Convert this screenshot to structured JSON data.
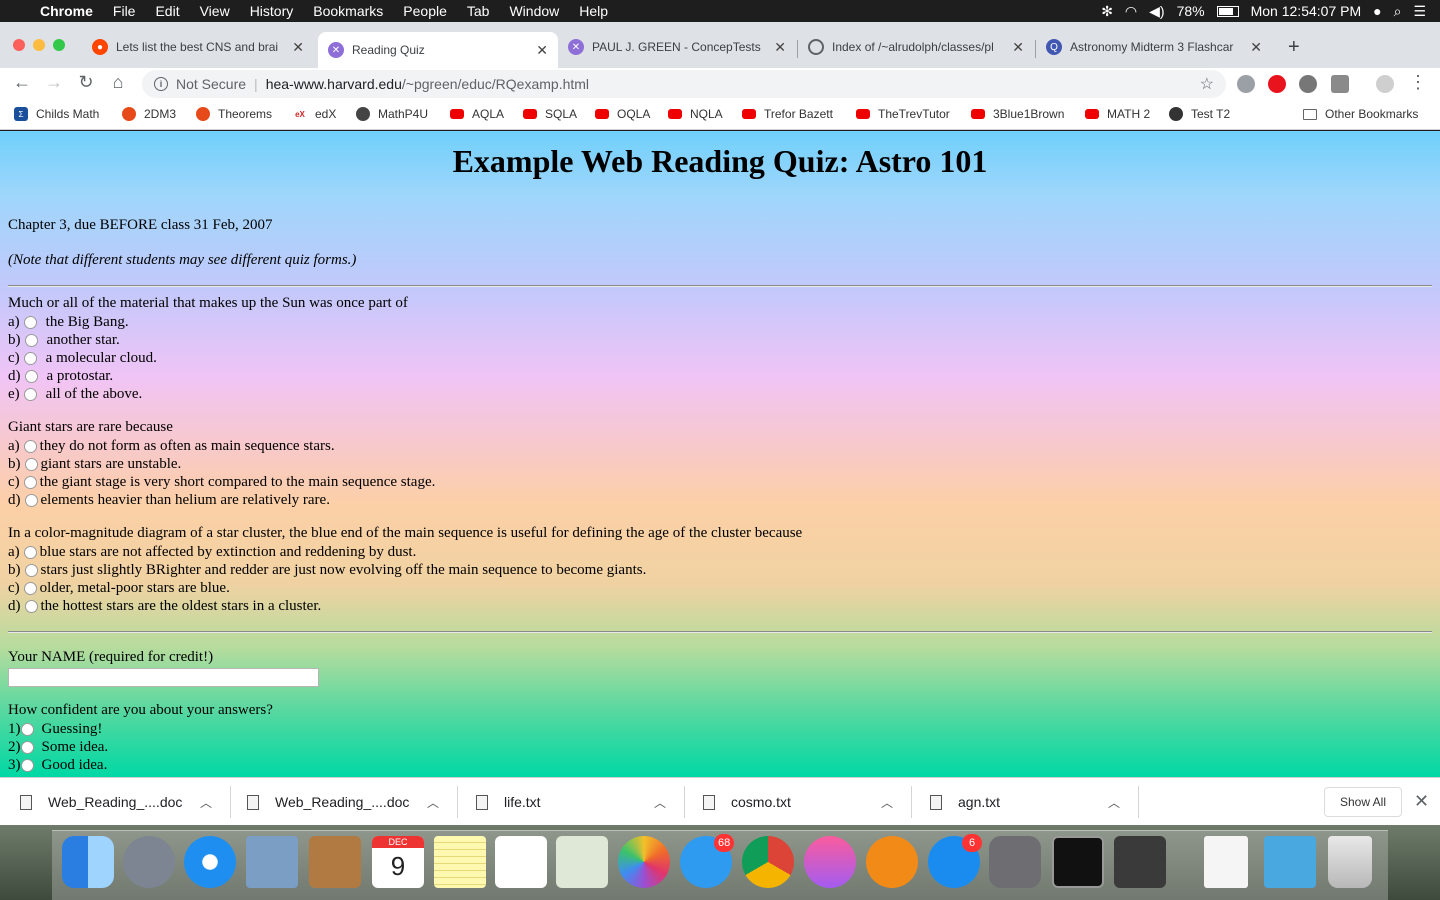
{
  "menubar": {
    "app_name": "Chrome",
    "items": [
      "File",
      "Edit",
      "View",
      "History",
      "Bookmarks",
      "People",
      "Tab",
      "Window",
      "Help"
    ],
    "battery": "78%",
    "clock": "Mon 12:54:07 PM"
  },
  "tabs": [
    {
      "label": "Lets list the best CNS and brai",
      "icon": "reddit-icon"
    },
    {
      "label": "Reading Quiz",
      "icon": "quiz-icon"
    },
    {
      "label": "PAUL J. GREEN - ConcepTests",
      "icon": "quiz-icon"
    },
    {
      "label": "Index of /~alrudolph/classes/pl",
      "icon": "loading-icon"
    },
    {
      "label": "Astronomy Midterm 3 Flashcar",
      "icon": "quizlet-icon"
    }
  ],
  "omnibox": {
    "security": "Not Secure",
    "host": "hea-www.harvard.edu",
    "path": "/~pgreen/educ/RQexamp.html"
  },
  "bookmarks": [
    "Childs Math",
    "2DM3",
    "Theorems",
    "edX",
    "MathP4U",
    "AQLA",
    "SQLA",
    "OQLA",
    "NQLA",
    "Trefor Bazett",
    "TheTrevTutor",
    "3Blue1Brown",
    "MATH 2",
    "Test T2"
  ],
  "other_bookmarks": "Other Bookmarks",
  "page": {
    "title": "Example Web Reading Quiz: Astro 101",
    "due": "Chapter 3, due BEFORE class 31 Feb, 2007",
    "note": "(Note that different students may see different quiz forms.)",
    "questions": [
      {
        "text": "Much or all of the material that makes up the Sun was once part of",
        "options": [
          {
            "letter": "a)",
            "text": "the Big Bang."
          },
          {
            "letter": "b)",
            "text": "another star."
          },
          {
            "letter": "c)",
            "text": "a molecular cloud."
          },
          {
            "letter": "d)",
            "text": "a protostar."
          },
          {
            "letter": "e)",
            "text": "all of the above."
          }
        ]
      },
      {
        "text": "Giant stars are rare because",
        "options": [
          {
            "letter": "a)",
            "text": "they do not form as often as main sequence stars."
          },
          {
            "letter": "b)",
            "text": "giant stars are unstable."
          },
          {
            "letter": "c)",
            "text": "the giant stage is very short compared to the main sequence stage."
          },
          {
            "letter": "d)",
            "text": "elements heavier than helium are relatively rare."
          }
        ]
      },
      {
        "text": "In a color-magnitude diagram of a star cluster, the blue end of the main sequence is useful for defining the age of the cluster because",
        "options": [
          {
            "letter": "a)",
            "text": "blue stars are not affected by extinction and reddening by dust."
          },
          {
            "letter": "b)",
            "text": "stars just slightly BRighter and redder are just now evolving off the main sequence to become giants."
          },
          {
            "letter": "c)",
            "text": "older, metal-poor stars are blue."
          },
          {
            "letter": "d)",
            "text": "the hottest stars are the oldest stars in a cluster."
          }
        ]
      }
    ],
    "name_label": "Your NAME (required for credit!)",
    "name_value": "",
    "confidence_question": "How confident are you about your answers?",
    "confidence_options": [
      {
        "letter": "1)",
        "text": "Guessing!"
      },
      {
        "letter": "2)",
        "text": "Some idea."
      },
      {
        "letter": "3)",
        "text": "Good idea."
      }
    ]
  },
  "downloads": [
    "Web_Reading_....doc",
    "Web_Reading_....doc",
    "life.txt",
    "cosmo.txt",
    "agn.txt"
  ],
  "show_all": "Show All",
  "dock": {
    "calendar_month": "DEC",
    "calendar_day": "9",
    "messages_badge": "68",
    "appstore_badge": "6"
  }
}
